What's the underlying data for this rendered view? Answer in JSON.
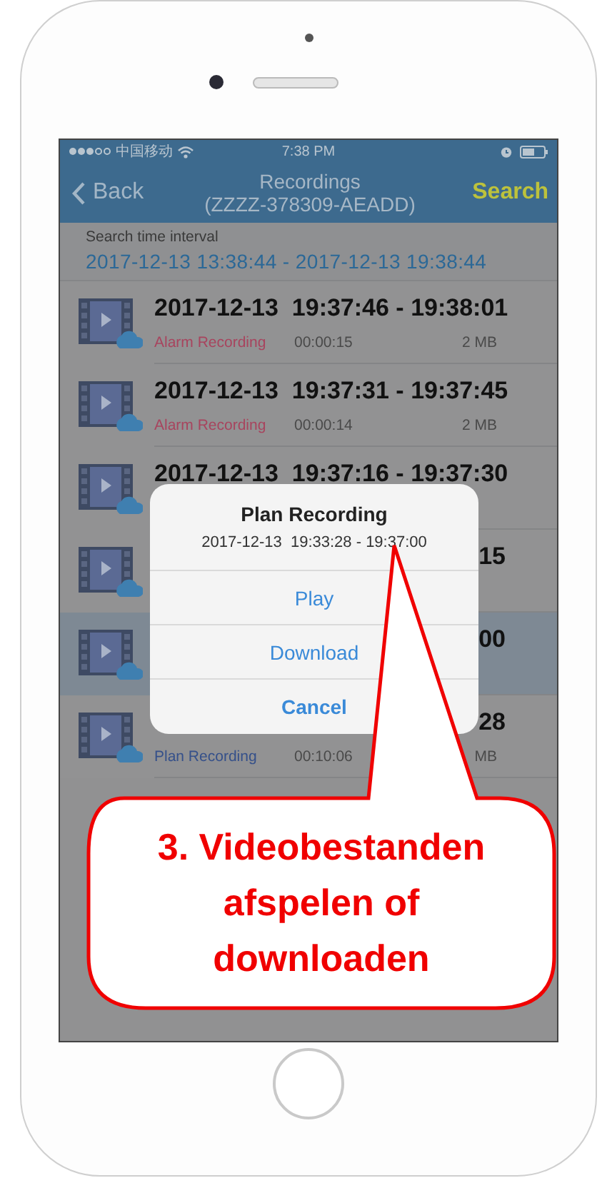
{
  "status_bar": {
    "carrier": "中国移动",
    "time": "7:38 PM"
  },
  "nav": {
    "back": "Back",
    "title": "Recordings",
    "subtitle": "(ZZZZ-378309-AEADD)",
    "action": "Search"
  },
  "search_interval": {
    "label": "Search time interval",
    "value": "2017-12-13 13:38:44 - 2017-12-13 19:38:44"
  },
  "recordings": [
    {
      "title": "2017-12-13  19:37:46 - 19:38:01",
      "color": "#a8445e",
      "type_label": "Alarm Recording",
      "duration": "00:00:15",
      "size": "2 MB",
      "selected": false
    },
    {
      "title": "2017-12-13  19:37:31 - 19:37:45",
      "color": "#a8445e",
      "type_label": "Alarm Recording",
      "duration": "00:00:14",
      "size": "2 MB",
      "selected": false
    },
    {
      "title": "2017-12-13  19:37:16 - 19:37:30",
      "selected": false
    },
    {
      "title_tail": "15",
      "selected": false
    },
    {
      "title_tail": "00",
      "selected": true
    },
    {
      "title_tail": "28",
      "color": "#35508a",
      "type_label": "Plan Recording",
      "duration": "00:10:06",
      "size": "MB",
      "selected": false
    }
  ],
  "dialog": {
    "title": "Plan Recording",
    "subtitle": "2017-12-13  19:33:28 - 19:37:00",
    "buttons": [
      {
        "label": "Play",
        "kind": "default"
      },
      {
        "label": "Download",
        "kind": "default"
      },
      {
        "label": "Cancel",
        "kind": "cancel"
      }
    ]
  },
  "callout": {
    "text": "3. Videobestanden afspelen of downloaden"
  }
}
